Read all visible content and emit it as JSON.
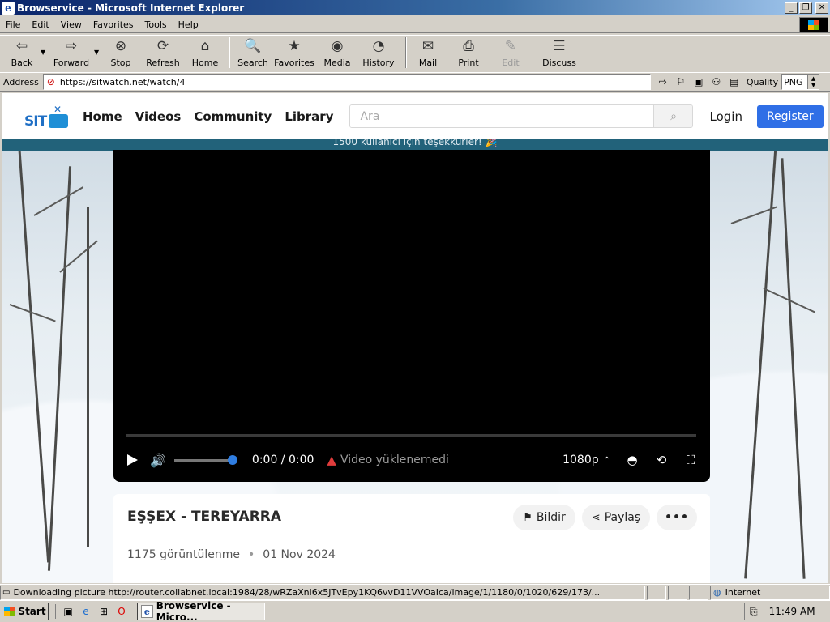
{
  "window": {
    "title": "Browservice - Microsoft Internet Explorer",
    "app_icon": "ie-page-icon",
    "buttons": [
      "minimize-icon",
      "restore-icon",
      "close-icon"
    ]
  },
  "menu": {
    "items": [
      "File",
      "Edit",
      "View",
      "Favorites",
      "Tools",
      "Help"
    ]
  },
  "toolbar": {
    "back": "Back",
    "forward": "Forward",
    "stop": "Stop",
    "refresh": "Refresh",
    "home": "Home",
    "search": "Search",
    "favorites": "Favorites",
    "media": "Media",
    "history": "History",
    "mail": "Mail",
    "print": "Print",
    "edit": "Edit",
    "discuss": "Discuss"
  },
  "address": {
    "label": "Address",
    "url": "https://sitwatch.net/watch/4",
    "quality_label": "Quality",
    "quality_value": "PNG"
  },
  "site": {
    "logo_text": "SIT",
    "nav": [
      "Home",
      "Videos",
      "Community",
      "Library"
    ],
    "search_placeholder": "Ara",
    "login": "Login",
    "register": "Register",
    "announcement": "1500 kullanıcı için teşekkürler! 🎉"
  },
  "player": {
    "time": "0:00 / 0:00",
    "error": "Video yüklenemedi",
    "quality": "1080p",
    "volume_level": 0.95
  },
  "video": {
    "title": "EŞŞEX - TEREYARRA",
    "report": "Bildir",
    "share": "Paylaş",
    "more": "•••",
    "views": "1175 görüntülenme",
    "separator": "•",
    "date": "01 Nov 2024"
  },
  "status": {
    "text": "Downloading picture http://router.collabnet.local:1984/28/wRZaXnl6x5JTvEpy1KQ6vvD11VVOaIca/image/1/1180/0/1020/629/173/...",
    "zone": "Internet"
  },
  "taskbar": {
    "start": "Start",
    "task": "Browservice - Micro...",
    "clock": "11:49 AM"
  },
  "colors": {
    "titlebar": "#0a246a",
    "register": "#2f6fe6",
    "announce": "#22627a",
    "volume_knob": "#2f7de1",
    "warning": "#e03c3c"
  }
}
